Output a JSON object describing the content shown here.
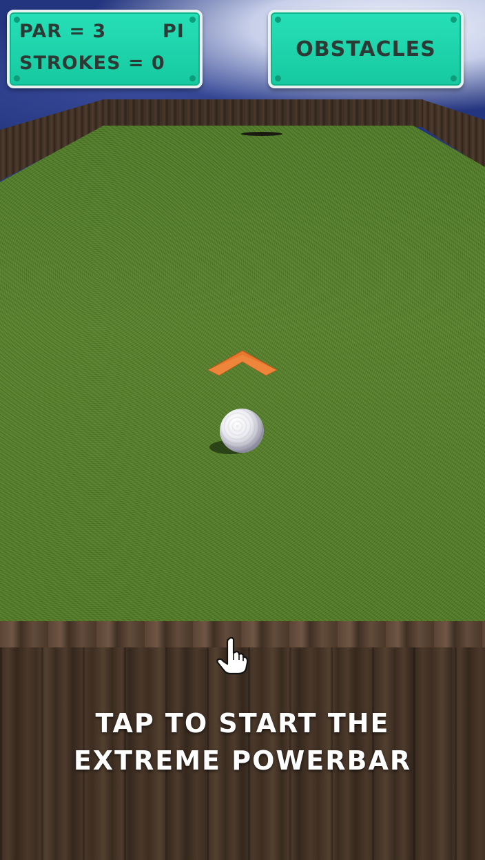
{
  "hud": {
    "par_label": "PAR = 3",
    "hole_label": "PI",
    "strokes_label": "STROKES = 0",
    "obstacles_button": "OBSTACLES"
  },
  "instructions": {
    "line1": "TAP TO START THE",
    "line2": "EXTREME POWERBAR"
  },
  "colors": {
    "hud_panel": "#1fd6ad",
    "hud_text": "#2c3a36",
    "grass": "#557f28",
    "arrow": "#e8772e"
  },
  "icons": {
    "aim": "aim-arrow-icon",
    "tap": "pointing-hand-icon"
  }
}
